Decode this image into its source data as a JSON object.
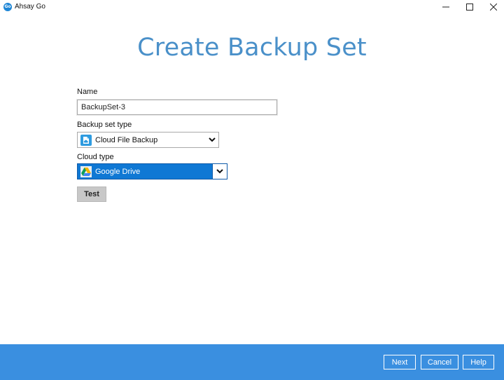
{
  "window": {
    "app_title": "Ahsay Go",
    "logo_text": "Go"
  },
  "page": {
    "title": "Create Backup Set"
  },
  "form": {
    "name_label": "Name",
    "name_value": "BackupSet-3",
    "backup_set_type_label": "Backup set type",
    "backup_set_type_value": "Cloud File Backup",
    "backup_set_type_icon": "cloud-file-icon",
    "cloud_type_label": "Cloud type",
    "cloud_type_value": "Google Drive",
    "cloud_type_icon": "google-drive-icon",
    "test_label": "Test"
  },
  "footer": {
    "next_label": "Next",
    "cancel_label": "Cancel",
    "help_label": "Help"
  },
  "colors": {
    "title": "#4a90c9",
    "footer": "#3a8fe0",
    "selected_select": "#0f78d4"
  }
}
